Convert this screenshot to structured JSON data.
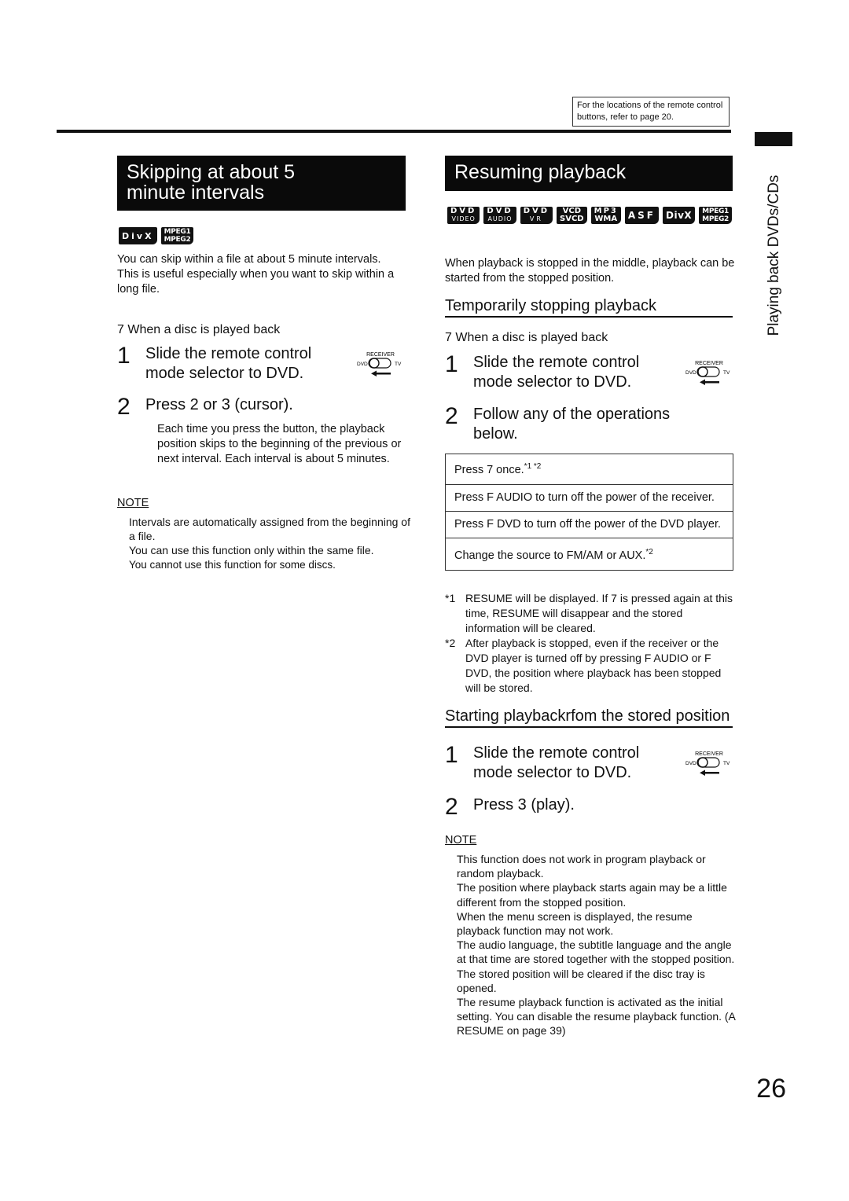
{
  "header": {
    "reference_note": "For the locations of the remote control buttons, refer to page 20."
  },
  "side_label": "Playing back DVDs/CDs",
  "page_number": "26",
  "left": {
    "title_line1": "Skipping at about 5",
    "title_line2": "minute intervals",
    "badges": [
      {
        "type": "single",
        "l1": "DivX"
      },
      {
        "type": "mpeg",
        "l1": "MPEG1",
        "l2": "MPEG2"
      }
    ],
    "intro": [
      "You can skip within a file at about 5 minute intervals.",
      "This is useful especially when you want to skip within a long file."
    ],
    "condition": "7   When a disc is played back",
    "steps": [
      {
        "num": "1",
        "text": "Slide the remote control mode selector to DVD."
      },
      {
        "num": "2",
        "text": "Press 2   or 3   (cursor)."
      }
    ],
    "step2_detail": "Each time you press the button, the playback position skips to the beginning of the previous or next interval. Each interval is about 5 minutes.",
    "note_heading": "NOTE",
    "notes": [
      "Intervals are automatically assigned from the beginning of a file.",
      "You can use this function only within the same file.",
      "You cannot use this function for some discs."
    ]
  },
  "right": {
    "title": "Resuming playback",
    "badges": [
      {
        "type": "dual",
        "l1": "DVD",
        "l2": "VIDEO"
      },
      {
        "type": "dual",
        "l1": "DVD",
        "l2": "AUDIO"
      },
      {
        "type": "dual",
        "l1": "DVD",
        "l2": "VR"
      },
      {
        "type": "two",
        "l1": "VCD",
        "l2": "SVCD"
      },
      {
        "type": "two",
        "l1": "MP3",
        "l2": "WMA"
      },
      {
        "type": "single",
        "l1": "ASF"
      },
      {
        "type": "single",
        "l1": "DivX"
      },
      {
        "type": "mpeg",
        "l1": "MPEG1",
        "l2": "MPEG2"
      }
    ],
    "intro": "When playback is stopped in the middle, playback can be started from the stopped position.",
    "sub1": {
      "heading": "Temporarily stopping playback",
      "condition": "7   When a disc is played back",
      "steps": [
        {
          "num": "1",
          "text": "Slide the remote control mode selector to DVD."
        },
        {
          "num": "2",
          "text": "Follow any of the operations below."
        }
      ],
      "operations": [
        {
          "text": "Press 7   once.",
          "sup": "*1 *2"
        },
        {
          "text": "Press F    AUDIO to turn off the power of the receiver.",
          "sup": ""
        },
        {
          "text": "Press F    DVD to turn off the power of the DVD player.",
          "sup": ""
        },
        {
          "text": "Change the source to FM/AM or AUX.",
          "sup": "*2"
        }
      ],
      "footnotes": [
        {
          "mark": "*1",
          "text": " RESUME  will be displayed. If 7   is pressed again at this time,  RESUME  will disappear and the stored information will be cleared."
        },
        {
          "mark": "*2",
          "text": "After playback is stopped, even if the receiver or the DVD player is turned off by pressing F    AUDIO or F    DVD, the position where playback has been stopped will be stored."
        }
      ]
    },
    "sub2": {
      "heading": "Starting playbackrfom the stored position",
      "steps": [
        {
          "num": "1",
          "text": "Slide the remote control mode selector to DVD."
        },
        {
          "num": "2",
          "text": "Press 3   (play)."
        }
      ],
      "note_heading": "NOTE",
      "notes": [
        "This function does not work in program playback or random playback.",
        "The position where playback starts again may be a little different from the stopped position.",
        "When the menu screen is displayed, the resume playback function may not work.",
        "The audio language, the subtitle language and the angle at that time are stored together with the stopped position.",
        "The stored position will be cleared if the disc tray is opened.",
        "The resume playback function is activated as the initial setting. You can disable the resume playback function. (A   RESUME  on page 39)"
      ]
    }
  },
  "selector_icon": {
    "top_label": "RECEIVER",
    "left_label": "DVD",
    "right_label": "TV"
  }
}
